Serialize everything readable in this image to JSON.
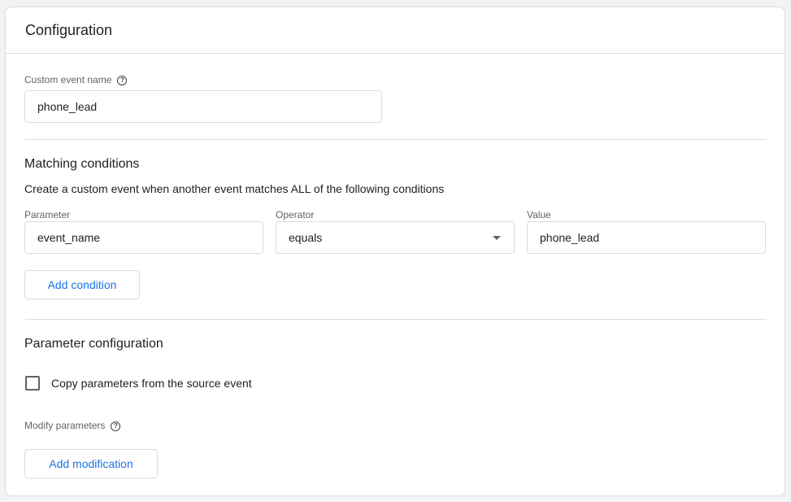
{
  "header": {
    "title": "Configuration"
  },
  "custom_event": {
    "label": "Custom event name",
    "help_icon": "help-circle-icon",
    "value": "phone_lead"
  },
  "matching": {
    "title": "Matching conditions",
    "description": "Create a custom event when another event matches ALL of the following conditions",
    "columns": {
      "parameter": "Parameter",
      "operator": "Operator",
      "value": "Value"
    },
    "condition": {
      "parameter": "event_name",
      "operator": "equals",
      "value": "phone_lead"
    },
    "add_condition_label": "Add condition"
  },
  "param_config": {
    "title": "Parameter configuration",
    "copy_label": "Copy parameters from the source event",
    "copy_checked": false,
    "modify_label": "Modify parameters",
    "help_icon": "help-circle-icon",
    "add_modification_label": "Add modification"
  },
  "colors": {
    "accent": "#1a73e8",
    "border": "#dadce0",
    "background": "#f1f3f4"
  }
}
